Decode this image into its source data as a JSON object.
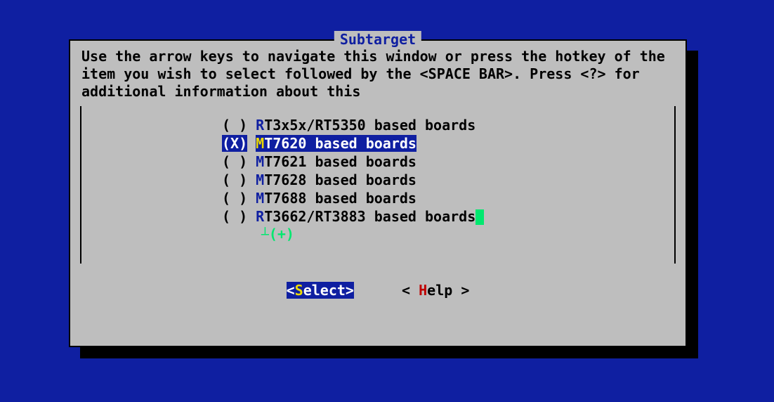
{
  "title": "Subtarget",
  "instructions": "Use the arrow keys to navigate this window or press the hotkey of the item you wish to select followed by the <SPACE BAR>. Press <?> for additional information about this",
  "options": [
    {
      "radio": "( )",
      "hot": "R",
      "rest": "T3x5x/RT5350 based boards",
      "selected": false
    },
    {
      "radio": "(X)",
      "hot": "M",
      "rest": "T7620 based boards",
      "selected": true
    },
    {
      "radio": "( )",
      "hot": "M",
      "rest": "T7621 based boards",
      "selected": false
    },
    {
      "radio": "( )",
      "hot": "M",
      "rest": "T7628 based boards",
      "selected": false
    },
    {
      "radio": "( )",
      "hot": "M",
      "rest": "T7688 based boards",
      "selected": false
    },
    {
      "radio": "( )",
      "hot": "R",
      "rest": "T3662/RT3883 based boards",
      "selected": false
    }
  ],
  "more_indicator": "(+)",
  "buttons": {
    "select": {
      "open": "<",
      "hot": "S",
      "rest": "elect",
      "close": ">"
    },
    "help": {
      "open": "< ",
      "hot": "H",
      "rest": "elp",
      "close": " >"
    }
  }
}
